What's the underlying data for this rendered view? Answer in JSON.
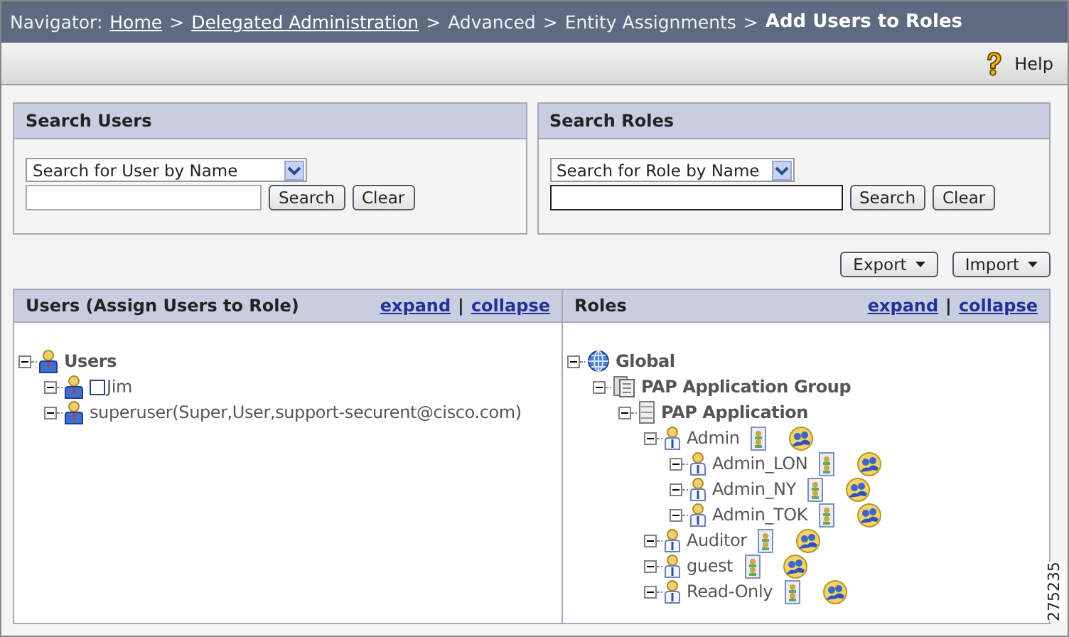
{
  "navigator": {
    "label": "Navigator:",
    "crumbs": [
      {
        "text": "Home",
        "link": true
      },
      {
        "text": "Delegated Administration",
        "link": true
      },
      {
        "text": "Advanced",
        "link": false
      },
      {
        "text": "Entity Assignments",
        "link": false
      }
    ],
    "separator": ">",
    "current": "Add Users to Roles"
  },
  "toolbar": {
    "help": "Help"
  },
  "search_users": {
    "title": "Search Users",
    "dropdown": "Search for User by Name",
    "buttons": [
      "Search",
      "Clear"
    ]
  },
  "search_roles": {
    "title": "Search Roles",
    "dropdown": "Search for Role by Name",
    "buttons": [
      "Search",
      "Clear"
    ]
  },
  "actions": [
    "Export",
    "Import"
  ],
  "users_panel": {
    "title": "Users (Assign Users to Role)",
    "links": [
      "expand",
      "collapse"
    ],
    "separator": "|",
    "tree": [
      {
        "label": "Users",
        "kind": "group",
        "children": [
          {
            "label": "Jim",
            "kind": "user",
            "checked": false
          },
          {
            "label": "superuser(Super,User,support-securent@cisco.com)",
            "kind": "user"
          }
        ]
      }
    ]
  },
  "roles_panel": {
    "title": "Roles",
    "links": [
      "expand",
      "collapse"
    ],
    "separator": "|",
    "tree": [
      {
        "label": "Global",
        "kind": "globe",
        "children": [
          {
            "label": "PAP Application Group",
            "kind": "server-group",
            "children": [
              {
                "label": "PAP Application",
                "kind": "server",
                "children": [
                  {
                    "label": "Admin",
                    "kind": "role",
                    "children": [
                      {
                        "label": "Admin_LON",
                        "kind": "role"
                      },
                      {
                        "label": "Admin_NY",
                        "kind": "role"
                      },
                      {
                        "label": "Admin_TOK",
                        "kind": "role"
                      }
                    ]
                  },
                  {
                    "label": "Auditor",
                    "kind": "role"
                  },
                  {
                    "label": "guest",
                    "kind": "role"
                  },
                  {
                    "label": "Read-Only",
                    "kind": "role"
                  }
                ]
              }
            ]
          }
        ]
      }
    ]
  },
  "figure_number": "275235"
}
